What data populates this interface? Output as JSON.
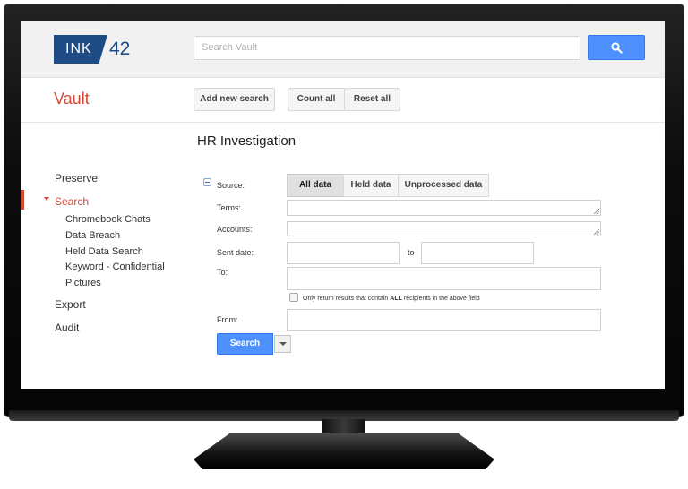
{
  "brand": {
    "logo_text": "INK",
    "logo_number": "42"
  },
  "header": {
    "search_placeholder": "Search Vault"
  },
  "app_title": "Vault",
  "toolbar": {
    "add_search": "Add new search",
    "count_all": "Count all",
    "reset_all": "Reset all"
  },
  "page_title": "HR Investigation",
  "sidebar": {
    "preserve": "Preserve",
    "search": "Search",
    "search_items": [
      "Chromebook Chats",
      "Data Breach",
      "Held Data Search",
      "Keyword - Confidential",
      "Pictures"
    ],
    "export": "Export",
    "audit": "Audit"
  },
  "form": {
    "source_label": "Source:",
    "source_options": [
      "All data",
      "Held data",
      "Unprocessed data"
    ],
    "selected_source": "All data",
    "terms_label": "Terms:",
    "accounts_label": "Accounts:",
    "sent_date_label": "Sent date:",
    "to_sep": "to",
    "to_label": "To:",
    "checkbox_prefix": "Only return results that contain",
    "checkbox_bold": "ALL",
    "checkbox_suffix": "recipients in the above field",
    "from_label": "From:",
    "search_button": "Search"
  },
  "colors": {
    "accent_red": "#d14836",
    "primary_blue": "#4d90fe",
    "logo_blue": "#1f4b85"
  }
}
